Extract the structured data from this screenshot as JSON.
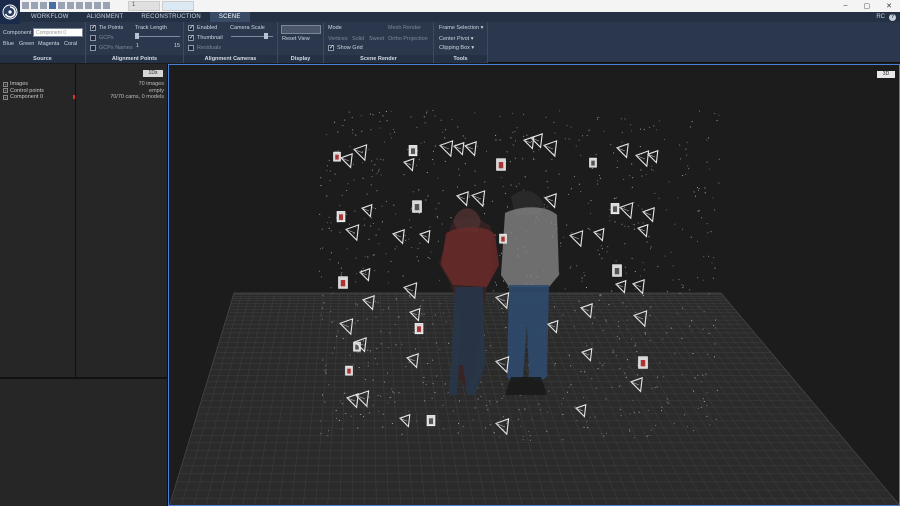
{
  "titlebar": {
    "tabs": [
      {
        "label": "1"
      },
      {
        "label": ""
      }
    ],
    "window_controls": {
      "minimize": "–",
      "maximize": "▢",
      "close": "✕"
    }
  },
  "menu": {
    "items": [
      {
        "label": "WORKFLOW"
      },
      {
        "label": "ALIGNMENT"
      },
      {
        "label": "RECONSTRUCTION"
      },
      {
        "label": "SCENE"
      }
    ],
    "user": "RC",
    "help": "?"
  },
  "ribbon": {
    "source": {
      "title": "Source",
      "component_label": "Component",
      "component_value": "Component 0",
      "colors": [
        "Blue",
        "Green",
        "Magenta",
        "Coral"
      ]
    },
    "alignment_points": {
      "title": "Alignment Points",
      "tie_points": "Tie Points",
      "gcps": "GCPs",
      "gcps_names": "GCPs Names",
      "track_length": "Track Length",
      "track_min": "1",
      "track_max": "15"
    },
    "alignment_cameras": {
      "title": "Alignment Cameras",
      "enabled": "Enabled",
      "thumbnail": "Thumbnail",
      "residuals": "Residuals",
      "camera_scale": "Camera Scale"
    },
    "display": {
      "title": "Display",
      "combo_placeholder": "",
      "reset_view": "Reset View"
    },
    "scene_render": {
      "title": "Scene Render",
      "mode": "Mode",
      "vertices": "Vertices",
      "solid": "Solid",
      "sweet": "Sweet",
      "show_grid": "Show Grid",
      "mesh_render": "Mesh Render",
      "ortho_projection": "Ortho Projection"
    },
    "tools": {
      "title": "Tools",
      "frame_selection": "Frame Selection ▾",
      "center_pivot": "Center Pivot ▾",
      "clipping_box": "Clipping Box ▾"
    }
  },
  "left_panel": {
    "toggle_label": "1Ds",
    "tree": [
      {
        "label": "Images",
        "value": "70 images"
      },
      {
        "label": "Control points",
        "value": "empty"
      },
      {
        "label": "Component 0",
        "value": "70/70 cams, 0 models"
      }
    ]
  },
  "viewport": {
    "view_label": "3D",
    "accent_color": "#4a7fd4"
  }
}
